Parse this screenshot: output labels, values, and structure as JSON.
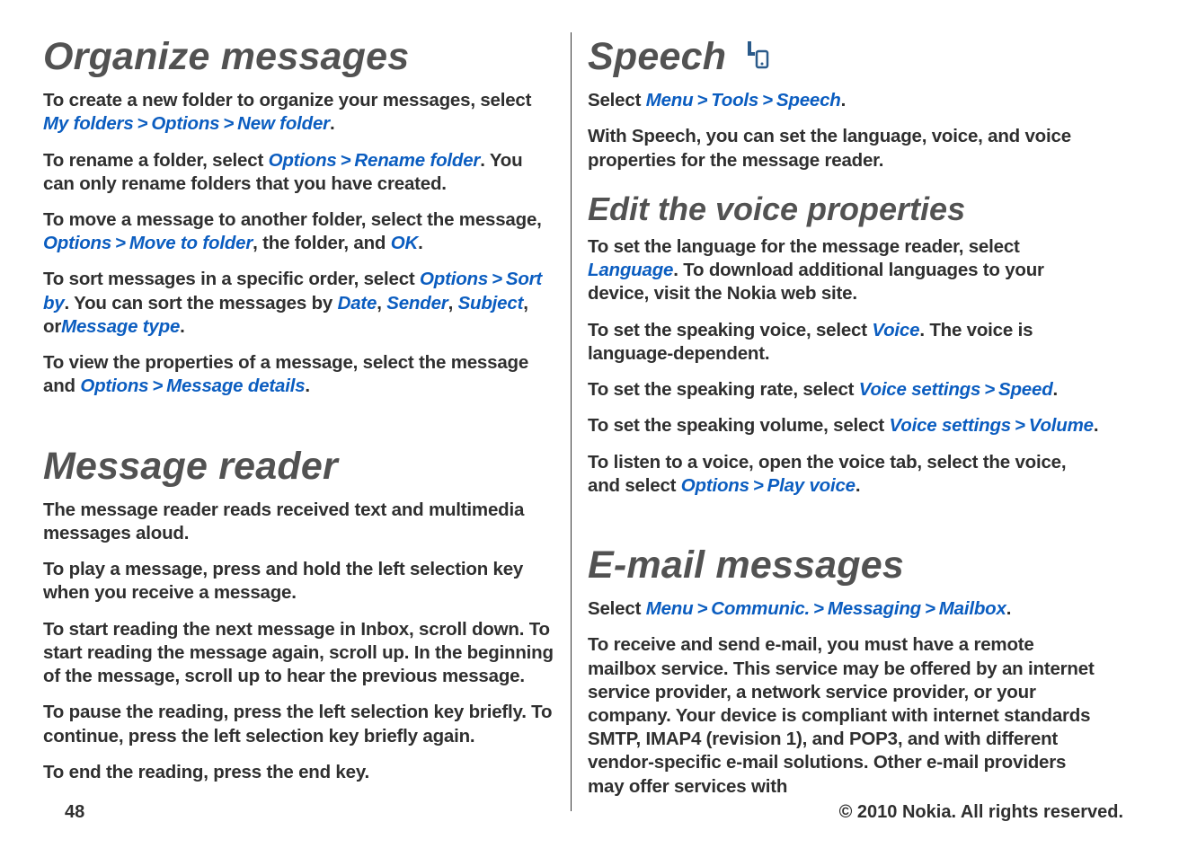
{
  "gt": ">",
  "left": {
    "h1a": "Organize messages",
    "p1a": "To create a new folder to organize your messages, select ",
    "p1_links": {
      "my_folders": "My folders",
      "options": "Options",
      "new_folder": "New folder"
    },
    "p1b": ".",
    "p2a": "To rename a folder, select ",
    "p2_links": {
      "options": "Options",
      "rename": "Rename folder"
    },
    "p2b": ". You can only rename folders that you have created.",
    "p3a": "To move a message to another folder, select the message, ",
    "p3_links": {
      "options": "Options",
      "move": "Move to folder",
      "ok": "OK"
    },
    "p3b": ", the folder, and ",
    "p3c": ".",
    "p4a": "To sort messages in a specific order, select ",
    "p4_links": {
      "options": "Options",
      "sort_by": "Sort by",
      "date": "Date",
      "sender": "Sender",
      "subject": "Subject",
      "mtype": "Message type"
    },
    "p4b": ". You can sort the messages by ",
    "p4c": ", or",
    "p4d": ".",
    "p5a": "To view the properties of a message, select the message and ",
    "p5_links": {
      "options": "Options",
      "details": "Message details"
    },
    "p5b": ".",
    "h1b": "Message reader",
    "p6": "The message reader reads received text and multimedia messages aloud.",
    "p7": "To play a message, press and hold the left selection key when you receive a message.",
    "p8": "To start reading the next message in Inbox, scroll down. To start reading the message again, scroll up. In the beginning of the message, scroll up to hear the previous message.",
    "p9": "To pause the reading, press the left selection key briefly. To continue, press the left selection key briefly again.",
    "p10": "To end the reading, press the end key."
  },
  "right": {
    "h1a": "Speech",
    "p1a": "Select ",
    "p1_links": {
      "menu": "Menu",
      "tools": "Tools",
      "speech": "Speech"
    },
    "p1b": ".",
    "p2": "With Speech, you can set the language, voice, and voice properties for the message reader.",
    "h2a": "Edit the voice properties",
    "p3a": "To set the language for the message reader, select ",
    "p3_links": {
      "language": "Language"
    },
    "p3b": ". To download additional languages to your device, visit the Nokia web site.",
    "p4a": "To set the speaking voice, select ",
    "p4_links": {
      "voice": "Voice"
    },
    "p4b": ". The voice is language-dependent.",
    "p5a": "To set the speaking rate, select ",
    "p5_links": {
      "voice_settings": "Voice settings",
      "speed": "Speed"
    },
    "p5b": ".",
    "p6a": "To set the speaking volume, select ",
    "p6_links": {
      "voice_settings": "Voice settings",
      "volume": "Volume"
    },
    "p6b": ".",
    "p7a": "To listen to a voice, open the voice tab, select the voice, and select ",
    "p7_links": {
      "options": "Options",
      "play": "Play voice"
    },
    "p7b": ".",
    "h1b": "E-mail messages",
    "p8a": "Select ",
    "p8_links": {
      "menu": "Menu",
      "communic": "Communic.",
      "messaging": "Messaging",
      "mailbox": "Mailbox"
    },
    "p8b": ".",
    "p9": "To receive and send e-mail, you must have a remote mailbox service. This service may be offered by an internet service provider, a network service provider, or your company. Your device is compliant with internet standards SMTP, IMAP4 (revision 1), and POP3, and with different vendor-specific e-mail solutions. Other e-mail providers may offer services with"
  },
  "footer": {
    "page": "48",
    "copyright": "© 2010 Nokia. All rights reserved."
  }
}
